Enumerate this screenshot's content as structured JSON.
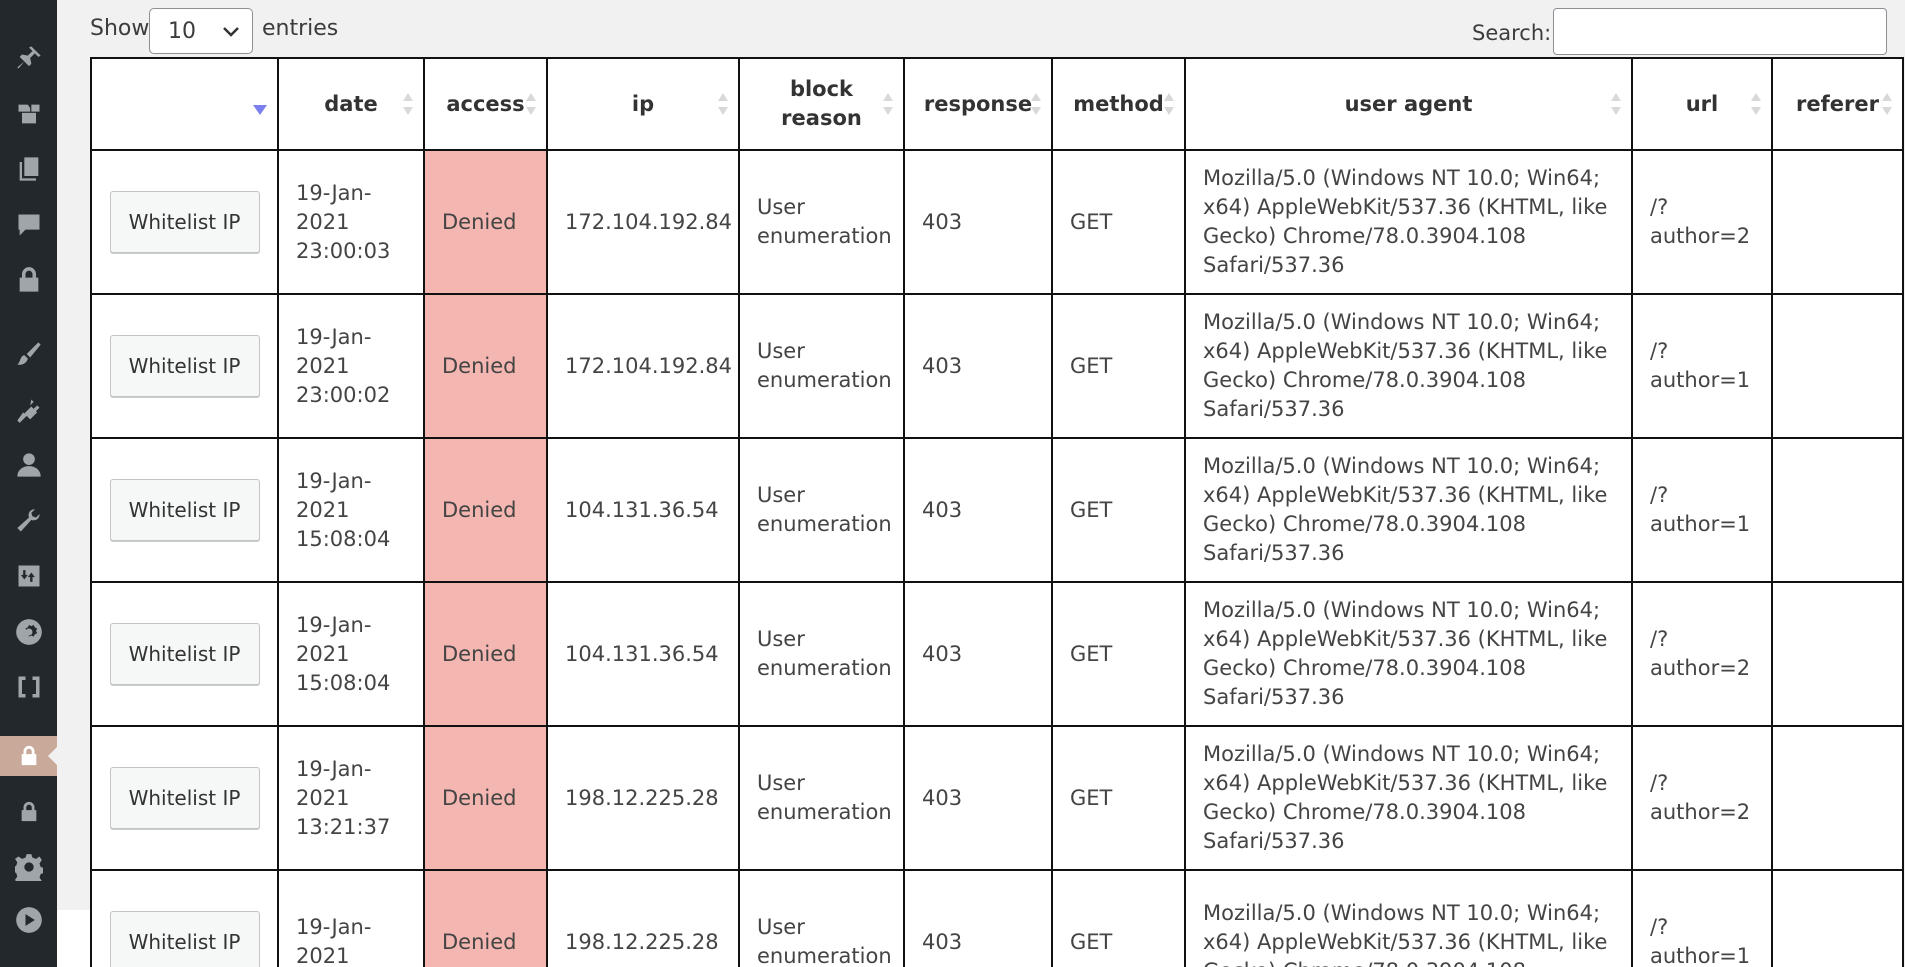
{
  "sidebar": {
    "icons": [
      "pin-icon",
      "media-icon",
      "pages-icon",
      "comments-icon",
      "lock-icon",
      "appearance-icon",
      "plugins-icon",
      "users-icon",
      "tools-icon",
      "import-export-icon",
      "settings-gear-icon",
      "brackets-icon",
      "security-lock-icon",
      "lock-icon",
      "gear-icon",
      "play-icon"
    ],
    "active_color": "#c8a99a"
  },
  "controls": {
    "show_label": "Show",
    "entries_label": "entries",
    "length_value": "10",
    "search_label": "Search:",
    "search_value": ""
  },
  "table": {
    "headers": [
      "",
      "date",
      "access",
      "ip",
      "block reason",
      "response",
      "method",
      "user agent",
      "url",
      "referer"
    ],
    "button_label": "Whitelist IP",
    "denied_color": "#f4b6b1",
    "rows": [
      {
        "date": "19-Jan-2021 23:00:03",
        "access": "Denied",
        "ip": "172.104.192.84",
        "reason": "User enumeration",
        "response": "403",
        "method": "GET",
        "ua": "Mozilla/5.0 (Windows NT 10.0; Win64; x64) AppleWebKit/537.36 (KHTML, like Gecko) Chrome/78.0.3904.108 Safari/537.36",
        "url": "/?author=2",
        "referer": ""
      },
      {
        "date": "19-Jan-2021 23:00:02",
        "access": "Denied",
        "ip": "172.104.192.84",
        "reason": "User enumeration",
        "response": "403",
        "method": "GET",
        "ua": "Mozilla/5.0 (Windows NT 10.0; Win64; x64) AppleWebKit/537.36 (KHTML, like Gecko) Chrome/78.0.3904.108 Safari/537.36",
        "url": "/?author=1",
        "referer": ""
      },
      {
        "date": "19-Jan-2021 15:08:04",
        "access": "Denied",
        "ip": "104.131.36.54",
        "reason": "User enumeration",
        "response": "403",
        "method": "GET",
        "ua": "Mozilla/5.0 (Windows NT 10.0; Win64; x64) AppleWebKit/537.36 (KHTML, like Gecko) Chrome/78.0.3904.108 Safari/537.36",
        "url": "/?author=1",
        "referer": ""
      },
      {
        "date": "19-Jan-2021 15:08:04",
        "access": "Denied",
        "ip": "104.131.36.54",
        "reason": "User enumeration",
        "response": "403",
        "method": "GET",
        "ua": "Mozilla/5.0 (Windows NT 10.0; Win64; x64) AppleWebKit/537.36 (KHTML, like Gecko) Chrome/78.0.3904.108 Safari/537.36",
        "url": "/?author=2",
        "referer": ""
      },
      {
        "date": "19-Jan-2021 13:21:37",
        "access": "Denied",
        "ip": "198.12.225.28",
        "reason": "User enumeration",
        "response": "403",
        "method": "GET",
        "ua": "Mozilla/5.0 (Windows NT 10.0; Win64; x64) AppleWebKit/537.36 (KHTML, like Gecko) Chrome/78.0.3904.108 Safari/537.36",
        "url": "/?author=2",
        "referer": ""
      },
      {
        "date": "19-Jan-2021",
        "access": "Denied",
        "ip": "198.12.225.28",
        "reason": "User enumeration",
        "response": "403",
        "method": "GET",
        "ua": "Mozilla/5.0 (Windows NT 10.0; Win64; x64) AppleWebKit/537.36 (KHTML, like Gecko) Chrome/78.0.3904.108",
        "url": "/?author=1",
        "referer": ""
      }
    ]
  }
}
